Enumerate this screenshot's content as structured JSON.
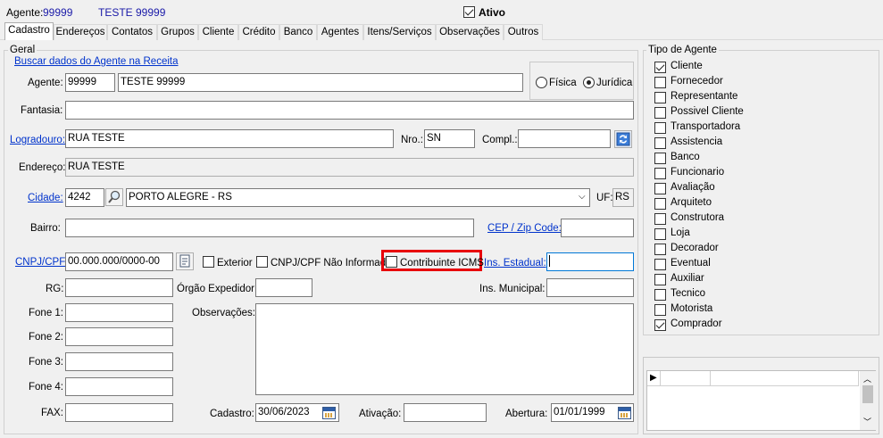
{
  "header": {
    "agent_label": "Agente:",
    "agent_code": "99999",
    "agent_name": "TESTE 99999",
    "ativo_label": "Ativo",
    "ativo_checked": true
  },
  "tabs": [
    "Cadastro",
    "Endereços",
    "Contatos",
    "Grupos",
    "Cliente",
    "Crédito",
    "Banco",
    "Agentes",
    "Itens/Serviços",
    "Observações",
    "Outros"
  ],
  "active_tab": "Cadastro",
  "geral": {
    "title": "Geral",
    "buscar_link": "Buscar dados do Agente na Receita",
    "agente_label": "Agente:",
    "agente_code": "99999",
    "agente_name": "TESTE 99999",
    "fisica_label": "Física",
    "juridica_label": "Jurídica",
    "tipo_pessoa": "Jurídica",
    "fantasia_label": "Fantasia:",
    "fantasia_value": "",
    "logradouro_label": "Logradouro:",
    "logradouro_value": "RUA TESTE",
    "nro_label": "Nro.:",
    "nro_value": "SN",
    "compl_label": "Compl.:",
    "compl_value": "",
    "endereco_label": "Endereço:",
    "endereco_value": "RUA TESTE",
    "cidade_label": "Cidade:",
    "cidade_code": "4242",
    "cidade_name": "PORTO ALEGRE - RS",
    "uf_label": "UF:",
    "uf_value": "RS",
    "bairro_label": "Bairro:",
    "bairro_value": "",
    "cep_label": "CEP / Zip Code:",
    "cep_value": "",
    "cnpj_label": "CNPJ/CPF:",
    "cnpj_value": "00.000.000/0000-00",
    "exterior_label": "Exterior",
    "cnpj_nao_informado_label": "CNPJ/CPF Não Informado",
    "contribuinte_label": "Contribuinte ICMS",
    "ins_estadual_label": "Ins. Estadual:",
    "ins_estadual_value": "",
    "rg_label": "RG:",
    "rg_value": "",
    "orgao_label": "Órgão Expedidor:",
    "orgao_value": "",
    "ins_municipal_label": "Ins. Municipal:",
    "ins_municipal_value": "",
    "fone1_label": "Fone 1:",
    "fone2_label": "Fone 2:",
    "fone3_label": "Fone 3:",
    "fone4_label": "Fone 4:",
    "fax_label": "FAX:",
    "observacoes_label": "Observações:",
    "cadastro_label": "Cadastro:",
    "cadastro_value": "30/06/2023",
    "ativacao_label": "Ativação:",
    "ativacao_value": "",
    "abertura_label": "Abertura:",
    "abertura_value": "01/01/1999"
  },
  "tipo_agente": {
    "title": "Tipo de Agente",
    "items": [
      {
        "label": "Cliente",
        "checked": true
      },
      {
        "label": "Fornecedor",
        "checked": false
      },
      {
        "label": "Representante",
        "checked": false
      },
      {
        "label": "Possivel Cliente",
        "checked": false
      },
      {
        "label": "Transportadora",
        "checked": false
      },
      {
        "label": "Assistencia",
        "checked": false
      },
      {
        "label": "Banco",
        "checked": false
      },
      {
        "label": "Funcionario",
        "checked": false
      },
      {
        "label": "Avaliação",
        "checked": false
      },
      {
        "label": "Arquiteto",
        "checked": false
      },
      {
        "label": "Construtora",
        "checked": false
      },
      {
        "label": "Loja",
        "checked": false
      },
      {
        "label": "Decorador",
        "checked": false
      },
      {
        "label": "Eventual",
        "checked": false
      },
      {
        "label": "Auxiliar",
        "checked": false
      },
      {
        "label": "Tecnico",
        "checked": false
      },
      {
        "label": "Motorista",
        "checked": false
      },
      {
        "label": "Comprador",
        "checked": true
      }
    ]
  },
  "colors": {
    "highlight": "#e8000b",
    "link": "#0033cc",
    "header_value": "#1a1aa8"
  }
}
